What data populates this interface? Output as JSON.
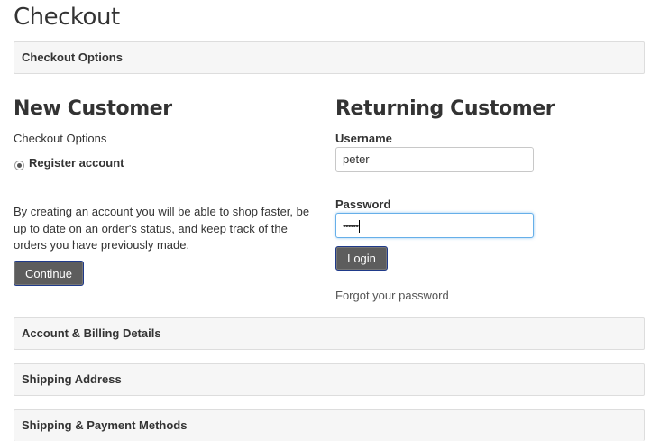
{
  "page": {
    "title": "Checkout"
  },
  "panels": {
    "checkout_options": "Checkout Options",
    "account_billing": "Account & Billing Details",
    "shipping_address": "Shipping Address",
    "shipping_payment": "Shipping & Payment Methods"
  },
  "new_customer": {
    "heading": "New Customer",
    "options_label": "Checkout Options",
    "radio_label": "Register account",
    "description": "By creating an account you will be able to shop faster, be up to date on an order's status, and keep track of the orders you have previously made.",
    "continue_button": "Continue"
  },
  "returning_customer": {
    "heading": "Returning Customer",
    "username_label": "Username",
    "username_value": "peter",
    "password_label": "Password",
    "password_value": "••••••",
    "login_button": "Login",
    "forgot_link": "Forgot your password"
  }
}
